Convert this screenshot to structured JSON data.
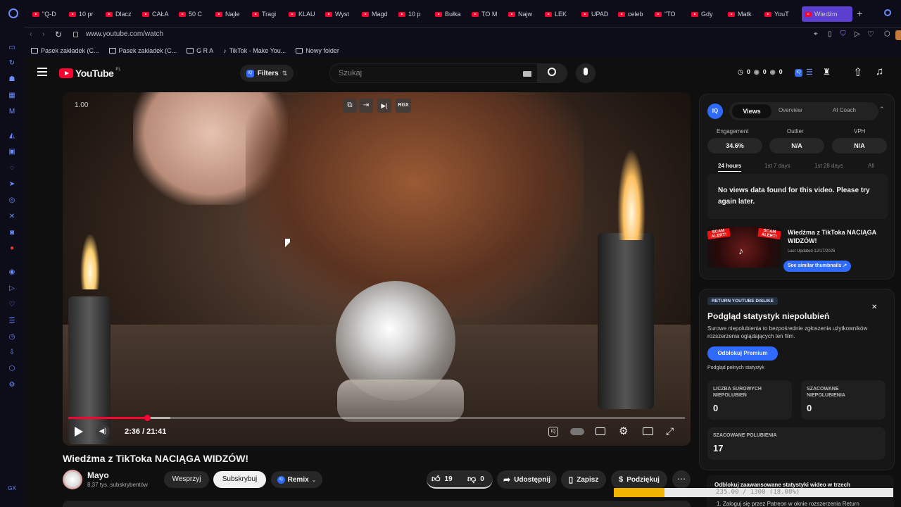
{
  "browser": {
    "tabs": [
      "\"Q-D",
      "10 pr",
      "Dlacz",
      "CAŁA",
      "50 C",
      "Najle",
      "Tragi",
      "KLAU",
      "Wyst",
      "Magd",
      "10 p",
      "Bułka",
      "TO M",
      "Najw",
      "LEK",
      "UPAD",
      "celeb",
      "\"TO",
      "Gdy",
      "Matk",
      "YouT",
      "Wiedźm"
    ],
    "url": "www.youtube.com/watch",
    "bookmarks": [
      "Pasek zakładek (C...",
      "Pasek zakładek (C...",
      "G R A",
      "TikTok - Make You...",
      "Nowy folder"
    ]
  },
  "header": {
    "logo_text": "YouTube",
    "region": "PL",
    "filters_label": "Filters",
    "search_placeholder": "Szukaj",
    "counters": [
      "0",
      "0",
      "0"
    ]
  },
  "player": {
    "speed": "1.00",
    "time": "2:36 / 21:41",
    "progress": 0.128,
    "buffered": 0.165,
    "top_buttons": [
      "RGX"
    ]
  },
  "video": {
    "title": "Wiedźma z TikToka NACIĄGA WIDZÓW!",
    "channel": "Mayo",
    "subscribers": "8,37 tys. subskrybentów",
    "support_label": "Wesprzyj",
    "subscribe_label": "Subskrybuj",
    "remix_label": "Remix",
    "likes": "19",
    "dislikes": "0",
    "share_label": "Udostępnij",
    "save_label": "Zapisz",
    "thanks_label": "Podziękuj"
  },
  "vidiq": {
    "tabs": [
      "Views",
      "Overview",
      "AI Coach"
    ],
    "metric_labels": [
      "Engagement",
      "Outlier",
      "VPH"
    ],
    "metric_values": [
      "34.6%",
      "N/A",
      "N/A"
    ],
    "ranges": [
      "24 hours",
      "1st 7 days",
      "1st 28 days",
      "All"
    ],
    "no_data": "No views data found for this video. Please try again later.",
    "thumb_title": "Wiedźma z TikToka NACIĄGA WIDZÓW!",
    "last_updated": "Last Updated 12/17/2025",
    "similar_label": "See similar thumbnails",
    "thumb_badge": "SCAM ALERT!"
  },
  "ryd": {
    "tag": "RETURN YOUTUBE DISLIKE",
    "heading": "Podgląd statystyk niepolubień",
    "description": "Surowe niepolubienia to bezpośrednie zgłoszenia użytkowników rozszerzenia oglądających ten film.",
    "premium_label": "Odblokuj Premium",
    "full_stats": "Podgląd pełnych statystyk",
    "box1_label": "LICZBA SUROWYCH NIEPOLUBIEŃ",
    "box1_value": "0",
    "box2_label": "SZACOWANE NIEPOLUBIENIA",
    "box2_value": "0",
    "box3_label": "SZACOWANE POLUBIENIA",
    "box3_value": "17",
    "bottom_text": "Odblokuj zaawansowane statystyki wideo w trzech krokach",
    "bottom_step": "1. Zaloguj się przez Patreon w oknie rozszerzenia Return"
  },
  "download": {
    "text": "235.00 / 1300 (18.08%)",
    "progress": 0.1808
  },
  "colors": {
    "accent": "#ff0033",
    "vidiq_blue": "#2f6bff",
    "panel": "#161616"
  }
}
